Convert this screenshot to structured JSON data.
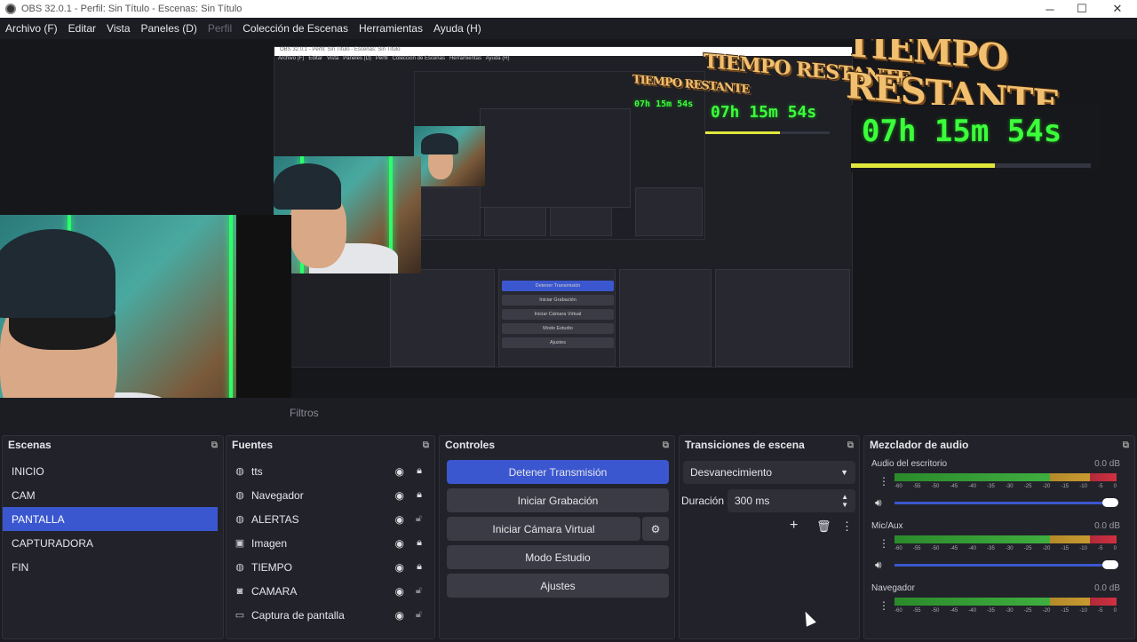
{
  "window": {
    "title": "OBS 32.0.1 - Perfil: Sin Título - Escenas: Sin Título",
    "minimize": "─",
    "maximize": "☐",
    "close": "✕"
  },
  "menu": {
    "items": [
      "Archivo (F)",
      "Editar",
      "Vista",
      "Paneles (D)",
      "Perfil",
      "Colección de Escenas",
      "Herramientas",
      "Ayuda (H)"
    ]
  },
  "preview": {
    "timer_title": "TIEMPO RESTANTE",
    "timer_value": "07h 15m 54s",
    "progress_fraction": 0.6,
    "nested_controls": [
      "Detener Transmisión",
      "Iniciar Grabación",
      "Iniciar Cámara Virtual",
      "Modo Estudio",
      "Ajustes"
    ]
  },
  "tabs": {
    "filtros": "Filtros"
  },
  "scenes": {
    "title": "Escenas",
    "items": [
      "INICIO",
      "CAM",
      "PANTALLA",
      "CAPTURADORA",
      "FIN"
    ],
    "active": "PANTALLA"
  },
  "sources": {
    "title": "Fuentes",
    "items": [
      {
        "label": "tts",
        "icon": "globe-icon",
        "locked": true
      },
      {
        "label": "Navegador",
        "icon": "globe-icon",
        "locked": true
      },
      {
        "label": "ALERTAS",
        "icon": "globe-icon",
        "locked": false
      },
      {
        "label": "Imagen",
        "icon": "image-icon",
        "locked": true
      },
      {
        "label": "TIEMPO",
        "icon": "globe-icon",
        "locked": true
      },
      {
        "label": "CAMARA",
        "icon": "camera-icon",
        "locked": false
      },
      {
        "label": "Captura de pantalla",
        "icon": "monitor-icon",
        "locked": false
      }
    ]
  },
  "controls": {
    "title": "Controles",
    "stop_stream": "Detener Transmisión",
    "start_recording": "Iniciar Grabación",
    "start_virtual_cam": "Iniciar Cámara Virtual",
    "studio_mode": "Modo Estudio",
    "settings": "Ajustes"
  },
  "transitions": {
    "title": "Transiciones de escena",
    "transition": "Desvanecimiento",
    "duration_label": "Duración",
    "duration_value": "300 ms"
  },
  "mixer": {
    "title": "Mezclador de audio",
    "channels": [
      {
        "name": "Audio del escritorio",
        "db": "0.0 dB"
      },
      {
        "name": "Mic/Aux",
        "db": "0.0 dB"
      },
      {
        "name": "Navegador",
        "db": "0.0 dB"
      }
    ],
    "ticks": [
      "-60",
      "-55",
      "-50",
      "-45",
      "-40",
      "-35",
      "-30",
      "-25",
      "-20",
      "-15",
      "-10",
      "-5",
      "0"
    ]
  },
  "colors": {
    "accent": "#3b57d0",
    "timer_green": "#3cff3c",
    "timer_gold": "#f0c070"
  }
}
